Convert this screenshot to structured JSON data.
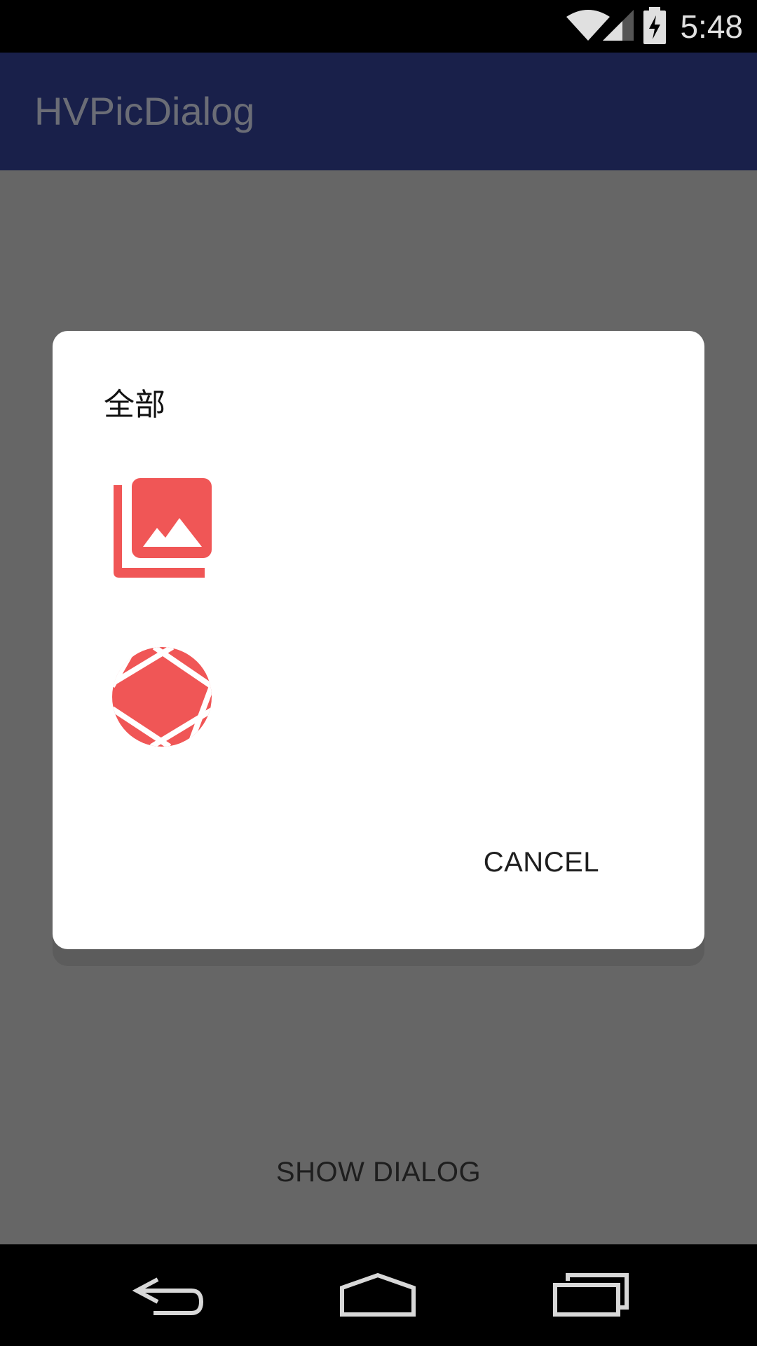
{
  "status_bar": {
    "time": "5:48",
    "icons": [
      "wifi-icon",
      "signal-icon",
      "battery-charging-icon"
    ]
  },
  "app_bar": {
    "title": "HVPicDialog"
  },
  "main": {
    "show_dialog_label": "SHOW DIALOG"
  },
  "dialog": {
    "title": "全部",
    "options": [
      {
        "icon": "photo-library-icon"
      },
      {
        "icon": "camera-shutter-icon"
      }
    ],
    "cancel_label": "CANCEL",
    "accent_color": "#f05656"
  },
  "nav_bar": {
    "buttons": [
      "back-icon",
      "home-icon",
      "recents-icon"
    ]
  }
}
